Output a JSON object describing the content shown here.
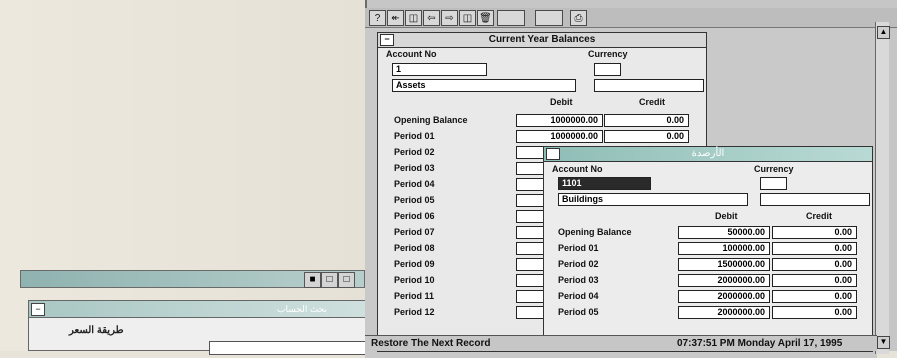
{
  "toolbar": {
    "help": "?",
    "icons": [
      "help-icon",
      "rewind-icon",
      "first-record-icon",
      "previous-record-icon",
      "next-record-icon",
      "last-record-icon",
      "delete-icon",
      "blank-a",
      "blank-b",
      "print-icon"
    ]
  },
  "back_window": {
    "title": "بحث الحساب",
    "label": "طريقة السعر",
    "buttons": [
      "■",
      "□",
      "□"
    ]
  },
  "window1": {
    "title": "Current Year Balances",
    "account_label": "Account No",
    "currency_label": "Currency",
    "account_no": "1",
    "account_name": "Assets",
    "currency": "",
    "debit_header": "Debit",
    "credit_header": "Credit",
    "rows": [
      {
        "label": "Opening Balance",
        "debit": "1000000.00",
        "credit": "0.00"
      },
      {
        "label": "Period 01",
        "debit": "1000000.00",
        "credit": "0.00"
      },
      {
        "label": "Period 02",
        "debit": "",
        "credit": ""
      },
      {
        "label": "Period 03",
        "debit": "",
        "credit": ""
      },
      {
        "label": "Period 04",
        "debit": "",
        "credit": ""
      },
      {
        "label": "Period 05",
        "debit": "",
        "credit": ""
      },
      {
        "label": "Period 06",
        "debit": "",
        "credit": ""
      },
      {
        "label": "Period 07",
        "debit": "",
        "credit": ""
      },
      {
        "label": "Period 08",
        "debit": "",
        "credit": ""
      },
      {
        "label": "Period 09",
        "debit": "",
        "credit": ""
      },
      {
        "label": "Period 10",
        "debit": "",
        "credit": ""
      },
      {
        "label": "Period 11",
        "debit": "",
        "credit": ""
      },
      {
        "label": "Period 12",
        "debit": "",
        "credit": ""
      }
    ]
  },
  "window2": {
    "title": "الأرصدة",
    "account_label": "Account No",
    "currency_label": "Currency",
    "account_no": "1101",
    "account_name": "Buildings",
    "currency": "",
    "debit_header": "Debit",
    "credit_header": "Credit",
    "rows": [
      {
        "label": "Opening Balance",
        "debit": "50000.00",
        "credit": "0.00"
      },
      {
        "label": "Period 01",
        "debit": "100000.00",
        "credit": "0.00"
      },
      {
        "label": "Period 02",
        "debit": "1500000.00",
        "credit": "0.00"
      },
      {
        "label": "Period 03",
        "debit": "2000000.00",
        "credit": "0.00"
      },
      {
        "label": "Period 04",
        "debit": "2000000.00",
        "credit": "0.00"
      },
      {
        "label": "Period 05",
        "debit": "2000000.00",
        "credit": "0.00"
      }
    ]
  },
  "status": {
    "message": "Restore The Next Record",
    "clock": "07:37:51 PM  Monday April 17, 1995"
  }
}
